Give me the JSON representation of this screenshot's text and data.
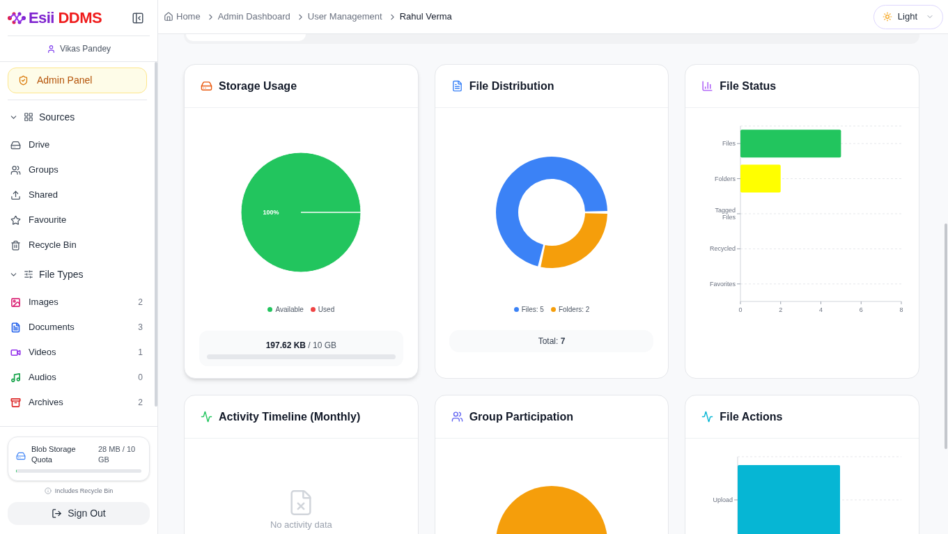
{
  "app": {
    "logo_first": "Esii",
    "logo_second": "DDMS",
    "user": "Vikas Pandey"
  },
  "sidebar": {
    "admin_button": "Admin Panel",
    "sections": [
      {
        "label": "Sources",
        "expanded": true,
        "items": [
          {
            "label": "Drive"
          },
          {
            "label": "Groups"
          },
          {
            "label": "Shared"
          },
          {
            "label": "Favourite"
          },
          {
            "label": "Recycle Bin"
          }
        ]
      },
      {
        "label": "File Types",
        "expanded": true,
        "items": [
          {
            "label": "Images",
            "count": "2",
            "color": "#db2777"
          },
          {
            "label": "Documents",
            "count": "3",
            "color": "#2563eb"
          },
          {
            "label": "Videos",
            "count": "1",
            "color": "#9333ea"
          },
          {
            "label": "Audios",
            "count": "0",
            "color": "#16a34a"
          },
          {
            "label": "Archives",
            "count": "2",
            "color": "#dc2626"
          }
        ]
      }
    ],
    "quota": {
      "label": "Blob Storage Quota",
      "value": "28 MB / 10 GB",
      "level": 0.003
    },
    "quota_note": "Includes Recycle Bin",
    "sign_out": "Sign Out"
  },
  "breadcrumb": [
    {
      "label": "Home",
      "selected": false
    },
    {
      "label": "Admin Dashboard",
      "selected": false
    },
    {
      "label": "User Management",
      "selected": false
    },
    {
      "label": "Rahul Verma",
      "selected": true
    }
  ],
  "theme": {
    "label": "Light"
  },
  "cards": [
    {
      "kind": "chart",
      "title": "Storage Usage",
      "chart_data": {
        "type": "pie",
        "categories": [
          "Available",
          "Used"
        ],
        "values": [
          100,
          0
        ],
        "value_labels": [
          "100%",
          null
        ]
      },
      "legend": [
        {
          "color": "#22c55e"
        },
        {
          "color": "#ef4444"
        }
      ],
      "usage": {
        "used": "197.62 KB",
        "total": " / 10 GB",
        "level": 0
      }
    },
    {
      "kind": "chart",
      "title": "File Distribution",
      "chart_data": {
        "type": "donut",
        "categories": [
          "Files: 5",
          "Folders: 2"
        ],
        "values": [
          5,
          2
        ]
      },
      "legend": [
        {
          "color": "#3b82f6"
        },
        {
          "color": "#f59e0b"
        }
      ],
      "total": "Total: **7**"
    },
    {
      "kind": "chart",
      "title": "File Status",
      "chart_data": {
        "type": "bar",
        "orientation": "horizontal",
        "categories": [
          "Files",
          "Folders",
          "Tagged Files",
          "Recycled",
          "Favorites"
        ],
        "series": [
          {
            "color": "#22c55e",
            "values": [
              5,
              null,
              0,
              0,
              0
            ]
          },
          {
            "color": "#ffff00",
            "values": [
              null,
              2,
              null,
              null,
              null
            ]
          }
        ],
        "xlim": [
          0,
          8
        ],
        "xticks": [
          0,
          2,
          4,
          6,
          8
        ]
      }
    },
    {
      "kind": "empty",
      "title": "Activity Timeline (Monthly)",
      "empty_text": "No activity data"
    },
    {
      "kind": "partial_pie",
      "title": "Group Participation"
    },
    {
      "kind": "partial_bar",
      "title": "File Actions",
      "bar_label": "Upload"
    }
  ]
}
